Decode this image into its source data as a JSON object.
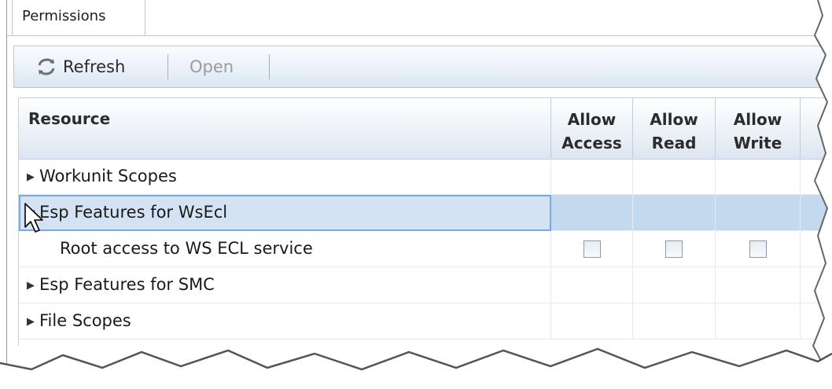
{
  "tab": {
    "label": "Permissions"
  },
  "toolbar": {
    "refresh_label": "Refresh",
    "open_label": "Open"
  },
  "grid": {
    "columns": {
      "resource": "Resource",
      "allow_access_1": "Allow",
      "allow_access_2": "Access",
      "allow_read_1": "Allow",
      "allow_read_2": "Read",
      "allow_write_1": "Allow",
      "allow_write_2": "Write"
    },
    "rows": [
      {
        "label": "Workunit Scopes",
        "expander": "collapsed"
      },
      {
        "label": "Esp Features for WsEcl",
        "expander": "expanded"
      },
      {
        "label": "Root access to WS ECL service",
        "allow_access": false,
        "allow_read": false,
        "allow_write": false
      },
      {
        "label": "Esp Features for SMC",
        "expander": "collapsed"
      },
      {
        "label": "File Scopes",
        "expander": "collapsed"
      }
    ]
  },
  "colors": {
    "toolbar_top": "#fbfdff",
    "toolbar_bottom": "#dbe7f3",
    "selected_row": "#c5d9ee",
    "border": "#b9c7d6"
  }
}
